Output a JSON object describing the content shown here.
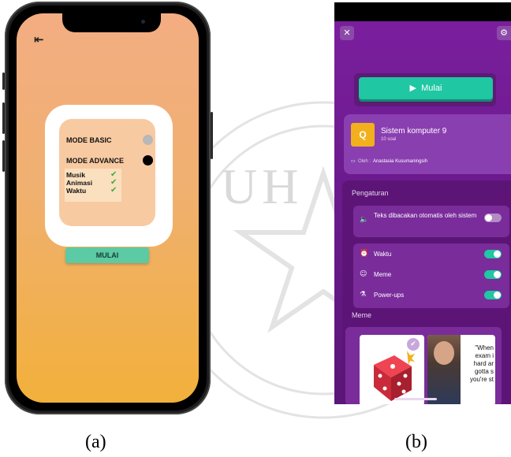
{
  "left_phone": {
    "back_icon": "exit-arrow-icon",
    "mode_basic": "MODE BASIC",
    "mode_advance": "MODE ADVANCE",
    "options": [
      "Musik",
      "Animasi",
      "Waktu"
    ],
    "start_label": "MULAI",
    "colors": {
      "accent": "#5ccaa4",
      "card": "#f8caa2",
      "check": "#3ea83c"
    }
  },
  "right_phone": {
    "close_icon": "close-icon",
    "gear_icon": "gear-icon",
    "start_label": "Mulai",
    "quiz": {
      "icon": "Q",
      "title": "Sistem komputer 9",
      "count": "10 soal",
      "author_label": "Oleh :",
      "author": "Anastasia Kusumaningsih"
    },
    "settings_title": "Pengaturan",
    "tts_label": "Teks dibacakan otomatis oleh sistem",
    "tts_on": false,
    "rows": [
      {
        "label": "Waktu",
        "icon": "alarm-clock-icon",
        "on": true
      },
      {
        "label": "Meme",
        "icon": "emoji-icon",
        "on": true
      },
      {
        "label": "Power-ups",
        "icon": "flask-icon",
        "on": true
      }
    ],
    "meme_title": "Meme",
    "meme_text": "\"When exam i hard ar gotta s you're st",
    "colors": {
      "accent": "#1fc7a3",
      "bg": "#7c1fa0"
    }
  },
  "captions": {
    "a": "(a)",
    "b": "(b)"
  },
  "watermark": "UH"
}
